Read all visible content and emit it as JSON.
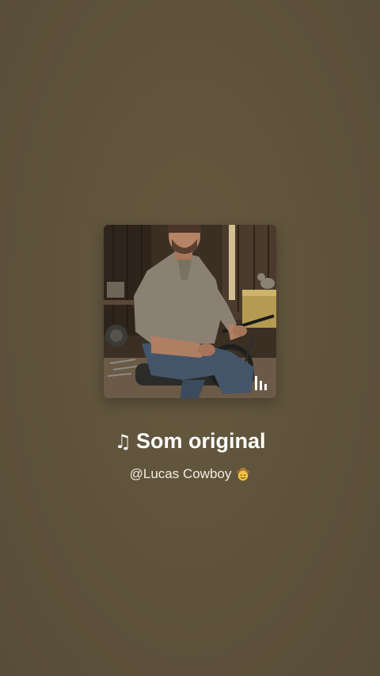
{
  "audio": {
    "note_icon": "♫",
    "title": "Som original",
    "author": "@Lucas Cowboy",
    "author_emoji": "cowboy-face-emoji"
  },
  "cover": {
    "image": "man-seated-on-motorcycle-in-barn",
    "badge_icon": "bars-chart-icon"
  },
  "colors": {
    "background": "#5f533c",
    "title": "#ffffff",
    "author": "#f1ece2"
  }
}
